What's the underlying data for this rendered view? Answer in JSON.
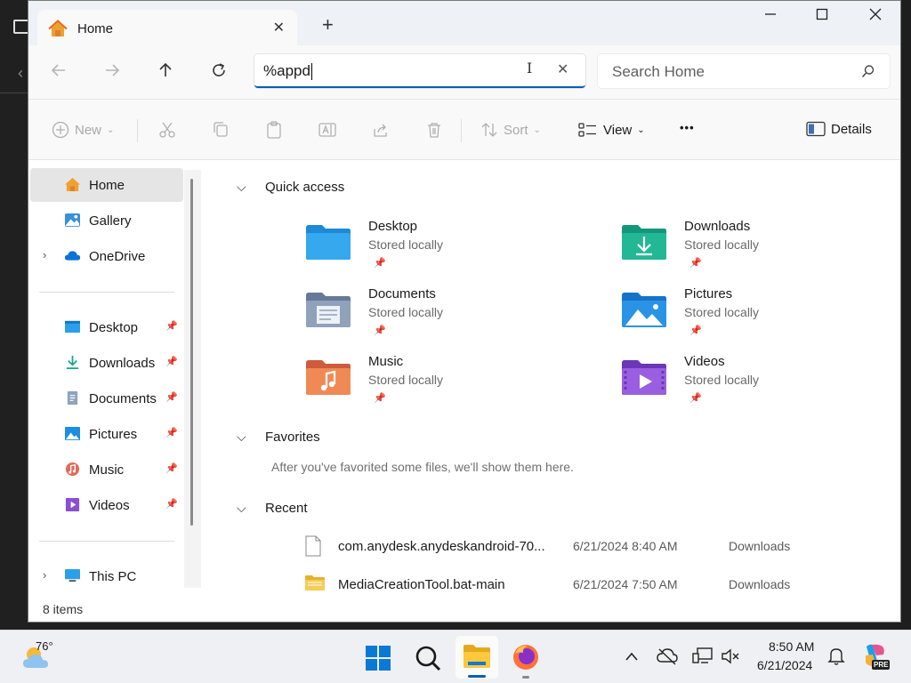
{
  "window": {
    "tab_title": "Home",
    "new_tab": "+",
    "tab_close": "✕"
  },
  "nav": {
    "address_value": "%appd",
    "address_clear": "✕",
    "search_placeholder": "Search Home"
  },
  "toolbar": {
    "new_label": "New",
    "sort_label": "Sort",
    "view_label": "View",
    "more_label": "•••",
    "details_label": "Details"
  },
  "sidebar": {
    "items": [
      {
        "label": "Home"
      },
      {
        "label": "Gallery"
      },
      {
        "label": "OneDrive"
      },
      {
        "label": "Desktop"
      },
      {
        "label": "Downloads"
      },
      {
        "label": "Documents"
      },
      {
        "label": "Pictures"
      },
      {
        "label": "Music"
      },
      {
        "label": "Videos"
      },
      {
        "label": "This PC"
      }
    ]
  },
  "status": {
    "items_count": "8 items"
  },
  "content": {
    "quick_access_title": "Quick access",
    "quick_access": [
      {
        "name": "Desktop",
        "sub": "Stored locally"
      },
      {
        "name": "Downloads",
        "sub": "Stored locally"
      },
      {
        "name": "Documents",
        "sub": "Stored locally"
      },
      {
        "name": "Pictures",
        "sub": "Stored locally"
      },
      {
        "name": "Music",
        "sub": "Stored locally"
      },
      {
        "name": "Videos",
        "sub": "Stored locally"
      }
    ],
    "favorites_title": "Favorites",
    "favorites_empty": "After you've favorited some files, we'll show them here.",
    "recent_title": "Recent",
    "recent": [
      {
        "name": "com.anydesk.anydeskandroid-70...",
        "date": "6/21/2024 8:40 AM",
        "location": "Downloads"
      },
      {
        "name": "MediaCreationTool.bat-main",
        "date": "6/21/2024 7:50 AM",
        "location": "Downloads"
      }
    ]
  },
  "taskbar": {
    "weather_temp": "76°",
    "time": "8:50 AM",
    "date": "6/21/2024",
    "copilot_badge": "PRE"
  },
  "colors": {
    "accent": "#005fb8",
    "folder_blue": "#2b9de8",
    "folder_teal": "#1aaf8e",
    "folder_gray": "#7f93ad",
    "folder_music": "#e8734a",
    "folder_video": "#8a4fd1"
  }
}
